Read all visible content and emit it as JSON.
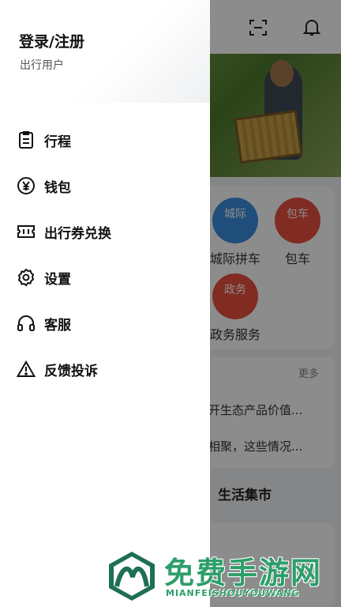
{
  "drawer": {
    "title": "登录/注册",
    "subtitle": "出行用户",
    "items": [
      {
        "label": "行程",
        "icon": "clipboard-icon"
      },
      {
        "label": "钱包",
        "icon": "yen-coin-icon"
      },
      {
        "label": "出行券兑换",
        "icon": "ticket-icon"
      },
      {
        "label": "设置",
        "icon": "gear-icon"
      },
      {
        "label": "客服",
        "icon": "headset-icon"
      },
      {
        "label": "反馈投诉",
        "icon": "warning-icon"
      }
    ]
  },
  "background": {
    "services": [
      {
        "badge": "城际",
        "label": "城际拼车",
        "color": "#3b8fe0"
      },
      {
        "badge": "包车",
        "label": "包车",
        "color": "#e9503f"
      },
      {
        "badge": "政务",
        "label": "政务服务",
        "color": "#e9503f"
      }
    ],
    "news": {
      "more": "更多",
      "lines": [
        "开生态产品价值...",
        "相聚，这些情况..."
      ]
    },
    "market_title": "生活集市"
  },
  "watermark": {
    "text": "免费手游网",
    "sub": "MIANFEISHOUYOUWANG"
  },
  "colors": {
    "accent_blue": "#3b8fe0",
    "accent_red": "#e9503f",
    "watermark_green": "#2d9e6a"
  }
}
